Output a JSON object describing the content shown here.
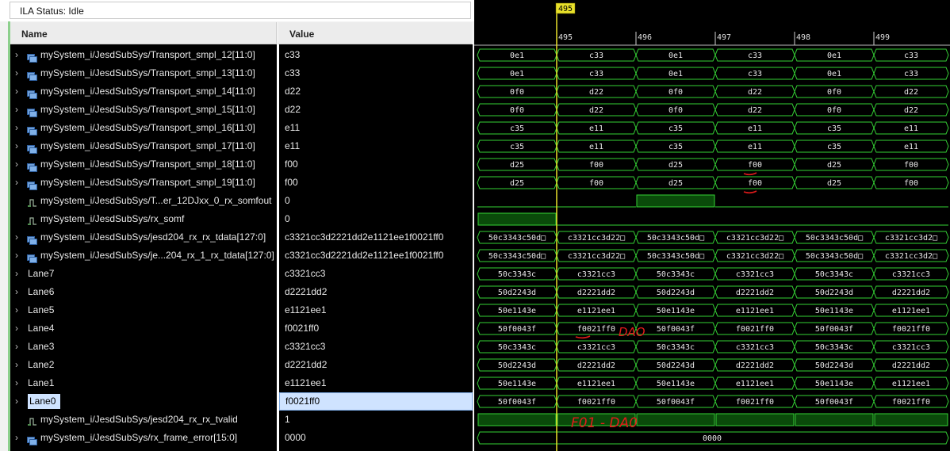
{
  "status": {
    "label": "ILA Status:",
    "value": "Idle"
  },
  "columns": {
    "name": "Name",
    "value": "Value"
  },
  "signals": [
    {
      "name": "mySystem_i/JesdSubSys/Transport_smpl_12[11:0]",
      "value": "c33",
      "kind": "bus",
      "expandable": true,
      "wave": [
        "0e1",
        "c33",
        "0e1",
        "c33",
        "0e1",
        "c33"
      ]
    },
    {
      "name": "mySystem_i/JesdSubSys/Transport_smpl_13[11:0]",
      "value": "c33",
      "kind": "bus",
      "expandable": true,
      "wave": [
        "0e1",
        "c33",
        "0e1",
        "c33",
        "0e1",
        "c33"
      ]
    },
    {
      "name": "mySystem_i/JesdSubSys/Transport_smpl_14[11:0]",
      "value": "d22",
      "kind": "bus",
      "expandable": true,
      "wave": [
        "0f0",
        "d22",
        "0f0",
        "d22",
        "0f0",
        "d22"
      ]
    },
    {
      "name": "mySystem_i/JesdSubSys/Transport_smpl_15[11:0]",
      "value": "d22",
      "kind": "bus",
      "expandable": true,
      "wave": [
        "0f0",
        "d22",
        "0f0",
        "d22",
        "0f0",
        "d22"
      ]
    },
    {
      "name": "mySystem_i/JesdSubSys/Transport_smpl_16[11:0]",
      "value": "e11",
      "kind": "bus",
      "expandable": true,
      "wave": [
        "c35",
        "e11",
        "c35",
        "e11",
        "c35",
        "e11"
      ]
    },
    {
      "name": "mySystem_i/JesdSubSys/Transport_smpl_17[11:0]",
      "value": "e11",
      "kind": "bus",
      "expandable": true,
      "wave": [
        "c35",
        "e11",
        "c35",
        "e11",
        "c35",
        "e11"
      ]
    },
    {
      "name": "mySystem_i/JesdSubSys/Transport_smpl_18[11:0]",
      "value": "f00",
      "kind": "bus",
      "expandable": true,
      "wave": [
        "d25",
        "f00",
        "d25",
        "f00",
        "d25",
        "f00"
      ]
    },
    {
      "name": "mySystem_i/JesdSubSys/Transport_smpl_19[11:0]",
      "value": "f00",
      "kind": "bus",
      "expandable": true,
      "wave": [
        "d25",
        "f00",
        "d25",
        "f00",
        "d25",
        "f00"
      ]
    },
    {
      "name": "mySystem_i/JesdSubSys/T...er_12DJxx_0_rx_somfout",
      "value": "0",
      "kind": "bit",
      "expandable": false,
      "bits": [
        0,
        0,
        1,
        0,
        0,
        0
      ]
    },
    {
      "name": "mySystem_i/JesdSubSys/rx_somf",
      "value": "0",
      "kind": "bit",
      "expandable": false,
      "bits": [
        1,
        0,
        0,
        0,
        0,
        0
      ]
    },
    {
      "name": "mySystem_i/JesdSubSys/jesd204_rx_rx_tdata[127:0]",
      "value": "c3321cc3d2221dd2e1121ee1f0021ff0",
      "kind": "bus",
      "expandable": true,
      "wave": [
        "50c3343c50d□",
        "c3321cc3d22□",
        "50c3343c50d□",
        "c3321cc3d22□",
        "50c3343c50d□",
        "c3321cc3d2□"
      ]
    },
    {
      "name": "mySystem_i/JesdSubSys/je...204_rx_1_rx_tdata[127:0]",
      "value": "c3321cc3d2221dd2e1121ee1f0021ff0",
      "kind": "bus",
      "expandable": true,
      "wave": [
        "50c3343c50d□",
        "c3321cc3d22□",
        "50c3343c50d□",
        "c3321cc3d22□",
        "50c3343c50d□",
        "c3321cc3d2□"
      ]
    },
    {
      "name": "Lane7",
      "value": "c3321cc3",
      "kind": "group",
      "expandable": true,
      "wave": [
        "50c3343c",
        "c3321cc3",
        "50c3343c",
        "c3321cc3",
        "50c3343c",
        "c3321cc3"
      ]
    },
    {
      "name": "Lane6",
      "value": "d2221dd2",
      "kind": "group",
      "expandable": true,
      "wave": [
        "50d2243d",
        "d2221dd2",
        "50d2243d",
        "d2221dd2",
        "50d2243d",
        "d2221dd2"
      ]
    },
    {
      "name": "Lane5",
      "value": "e1121ee1",
      "kind": "group",
      "expandable": true,
      "wave": [
        "50e1143e",
        "e1121ee1",
        "50e1143e",
        "e1121ee1",
        "50e1143e",
        "e1121ee1"
      ]
    },
    {
      "name": "Lane4",
      "value": "f0021ff0",
      "kind": "group",
      "expandable": true,
      "wave": [
        "50f0043f",
        "f0021ff0",
        "50f0043f",
        "f0021ff0",
        "50f0043f",
        "f0021ff0"
      ]
    },
    {
      "name": "Lane3",
      "value": "c3321cc3",
      "kind": "group",
      "expandable": true,
      "wave": [
        "50c3343c",
        "c3321cc3",
        "50c3343c",
        "c3321cc3",
        "50c3343c",
        "c3321cc3"
      ]
    },
    {
      "name": "Lane2",
      "value": "d2221dd2",
      "kind": "group",
      "expandable": true,
      "wave": [
        "50d2243d",
        "d2221dd2",
        "50d2243d",
        "d2221dd2",
        "50d2243d",
        "d2221dd2"
      ]
    },
    {
      "name": "Lane1",
      "value": "e1121ee1",
      "kind": "group",
      "expandable": true,
      "wave": [
        "50e1143e",
        "e1121ee1",
        "50e1143e",
        "e1121ee1",
        "50e1143e",
        "e1121ee1"
      ]
    },
    {
      "name": "Lane0",
      "value": "f0021ff0",
      "kind": "group",
      "expandable": true,
      "selected": true,
      "wave": [
        "50f0043f",
        "f0021ff0",
        "50f0043f",
        "f0021ff0",
        "50f0043f",
        "f0021ff0"
      ]
    },
    {
      "name": "mySystem_i/JesdSubSys/jesd204_rx_rx_tvalid",
      "value": "1",
      "kind": "bit",
      "expandable": false,
      "bits": [
        1,
        1,
        1,
        1,
        1,
        1
      ]
    },
    {
      "name": "mySystem_i/JesdSubSys/rx_frame_error[15:0]",
      "value": "0000",
      "kind": "bus",
      "expandable": true,
      "constant": "0000"
    }
  ],
  "timeline": {
    "ticks": [
      "495",
      "496",
      "497",
      "498",
      "499"
    ],
    "cursor": "495"
  },
  "annotations": {
    "lane4_note": "DAO",
    "lane0_note": "F01 - DA0"
  },
  "colors": {
    "wave_stroke": "#35d235",
    "high_fill": "#0a4a0a",
    "cursor": "#e8e02a",
    "annotation": "#e21b1b"
  },
  "icons": {
    "expand": "chevron-right-icon",
    "bus": "bus-signal-icon",
    "bit": "bit-signal-icon"
  }
}
